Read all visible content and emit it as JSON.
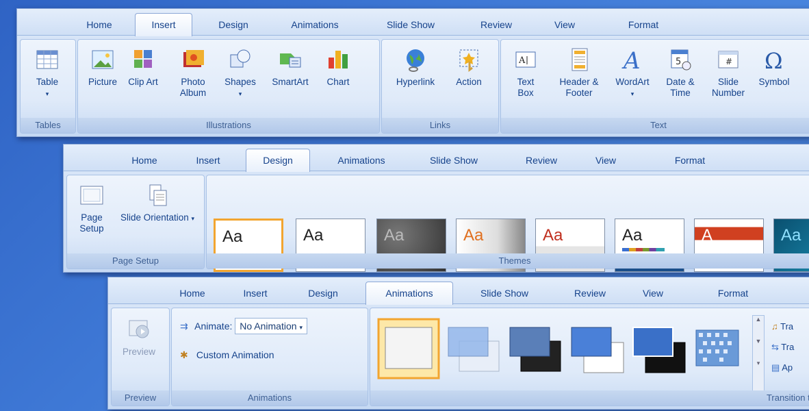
{
  "tabs": [
    "Home",
    "Insert",
    "Design",
    "Animations",
    "Slide Show",
    "Review",
    "View",
    "Format"
  ],
  "ribbon1": {
    "groups": {
      "tables": "Tables",
      "illustrations": "Illustrations",
      "links": "Links",
      "text": "Text"
    },
    "buttons": {
      "table": "Table",
      "picture": "Picture",
      "clipart": "Clip Art",
      "photo_album": "Photo Album",
      "shapes": "Shapes",
      "smartart": "SmartArt",
      "chart": "Chart",
      "hyperlink": "Hyperlink",
      "action": "Action",
      "textbox": "Text Box",
      "header_footer": "Header & Footer",
      "wordart": "WordArt",
      "date_time": "Date & Time",
      "slide_number": "Slide Number",
      "symbol": "Symbol"
    }
  },
  "ribbon2": {
    "groups": {
      "page_setup": "Page Setup",
      "themes": "Themes"
    },
    "buttons": {
      "page_setup": "Page Setup",
      "slide_orientation": "Slide Orientation"
    },
    "themes": [
      "Aa",
      "Aa",
      "Aa",
      "Aa",
      "Aa",
      "Aa",
      "A",
      "Aa"
    ]
  },
  "ribbon3": {
    "groups": {
      "preview": "Preview",
      "animations": "Animations",
      "transition": "Transition to"
    },
    "buttons": {
      "preview": "Preview",
      "animate_label": "Animate:",
      "animate_value": "No Animation",
      "custom_animation": "Custom Animation"
    },
    "side_items": [
      "Tra",
      "Tra",
      "Ap"
    ]
  },
  "colors": {
    "accent_selected": "#f2a530",
    "ribbon_text": "#15428b",
    "background": "#3f79d6"
  }
}
